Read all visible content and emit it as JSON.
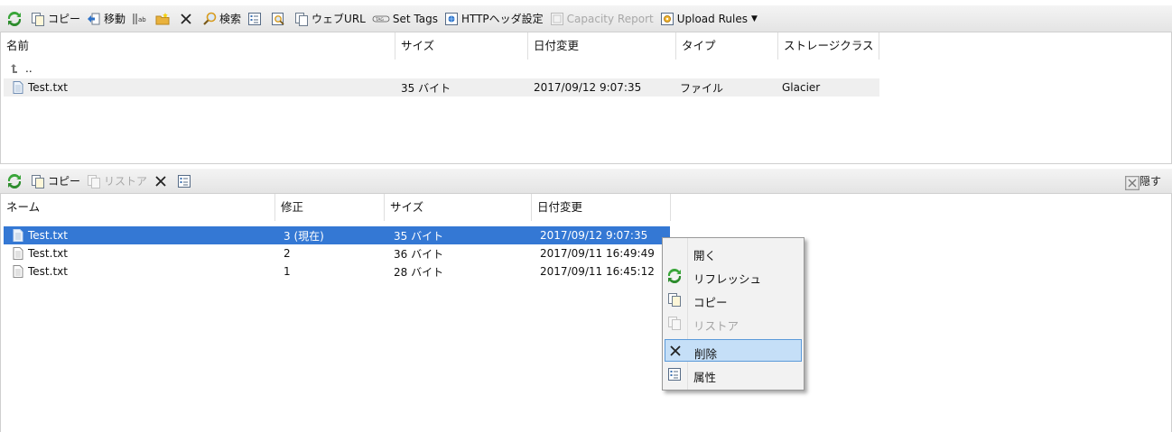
{
  "top_toolbar": {
    "items": [
      {
        "icon": "refresh-icon",
        "label": ""
      },
      {
        "icon": "copy-icon",
        "label": "コピー"
      },
      {
        "icon": "move-icon",
        "label": "移動"
      },
      {
        "icon": "rename-icon",
        "label": ""
      },
      {
        "icon": "new-folder-icon",
        "label": ""
      },
      {
        "icon": "delete-icon",
        "label": ""
      },
      {
        "icon": "search-icon",
        "label": "検索"
      },
      {
        "icon": "properties-icon",
        "label": ""
      },
      {
        "icon": "preview-icon",
        "label": ""
      },
      {
        "icon": "web-url-icon",
        "label": "ウェブURL"
      },
      {
        "icon": "tag-icon",
        "label": "Set Tags"
      },
      {
        "icon": "http-header-icon",
        "label": "HTTPヘッダ設定"
      },
      {
        "icon": "capacity-icon",
        "label": "Capacity Report"
      },
      {
        "icon": "upload-rules-icon",
        "label": "Upload Rules"
      }
    ]
  },
  "file_list": {
    "columns": [
      "名前",
      "サイズ",
      "日付変更",
      "タイプ",
      "ストレージクラス"
    ],
    "parent_label": "..",
    "rows": [
      {
        "name": "Test.txt",
        "size": "35 バイト",
        "modified": "2017/09/12 9:07:35",
        "type": "ファイル",
        "storage_class": "Glacier"
      }
    ]
  },
  "version_toolbar": {
    "copy_label": "コピー",
    "restore_label": "リストア",
    "hide_label": "隠す"
  },
  "version_list": {
    "columns": [
      "ネーム",
      "修正",
      "サイズ",
      "日付変更"
    ],
    "rows": [
      {
        "name": "Test.txt",
        "revision": "3 (現在)",
        "size": "35 バイト",
        "modified": "2017/09/12 9:07:35"
      },
      {
        "name": "Test.txt",
        "revision": "2",
        "size": "36 バイト",
        "modified": "2017/09/11 16:49:49"
      },
      {
        "name": "Test.txt",
        "revision": "1",
        "size": "28 バイト",
        "modified": "2017/09/11 16:45:12"
      }
    ]
  },
  "context_menu": {
    "items": [
      {
        "label": "開く",
        "icon": "",
        "state": "normal"
      },
      {
        "label": "リフレッシュ",
        "icon": "refresh-icon",
        "state": "normal"
      },
      {
        "label": "コピー",
        "icon": "copy-icon",
        "state": "normal"
      },
      {
        "label": "リストア",
        "icon": "restore-icon",
        "state": "disabled"
      },
      {
        "label": "削除",
        "icon": "delete-icon",
        "state": "hover"
      },
      {
        "label": "属性",
        "icon": "properties-icon",
        "state": "normal"
      }
    ]
  },
  "colors": {
    "selection": "#3478d4",
    "menu_hover": "#c5dff7",
    "alt_row": "#efefef"
  }
}
